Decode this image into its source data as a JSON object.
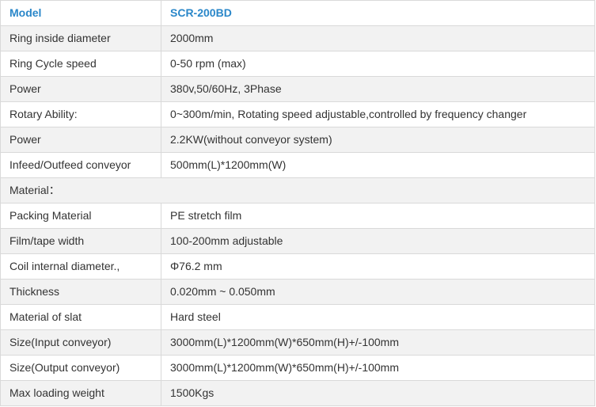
{
  "header": {
    "label": "Model",
    "value": "SCR-200BD"
  },
  "rows": [
    {
      "label": "Ring inside diameter",
      "value": "2000mm"
    },
    {
      "label": "Ring Cycle speed",
      "value": "0-50 rpm (max)"
    },
    {
      "label": "Power",
      "value": "380v,50/60Hz, 3Phase"
    },
    {
      "label": "Rotary Ability:",
      "value": "0~300m/min, Rotating speed adjustable,controlled by frequency changer"
    },
    {
      "label": "Power",
      "value": "2.2KW(without conveyor system)"
    },
    {
      "label": "Infeed/Outfeed conveyor",
      "value": "500mm(L)*1200mm(W)"
    },
    {
      "label": "Material：",
      "value": ""
    },
    {
      "label": "Packing Material",
      "value": "PE stretch film"
    },
    {
      "label": "Film/tape width",
      "value": "100-200mm adjustable"
    },
    {
      "label": "Coil internal diameter.,",
      "value": "Φ76.2 mm"
    },
    {
      "label": "Thickness",
      "value": "0.020mm ~ 0.050mm"
    },
    {
      "label": "Material of slat",
      "value": "Hard steel"
    },
    {
      "label": "Size(Input conveyor)",
      "value": "3000mm(L)*1200mm(W)*650mm(H)+/-100mm"
    },
    {
      "label": "Size(Output conveyor)",
      "value": "3000mm(L)*1200mm(W)*650mm(H)+/-100mm"
    },
    {
      "label": "Max loading weight",
      "value": "1500Kgs"
    }
  ],
  "colors": {
    "header_text": "#2a87c9",
    "body_text": "#333333",
    "border": "#d9d9d9",
    "row_alt_background": "#f2f2f2"
  }
}
